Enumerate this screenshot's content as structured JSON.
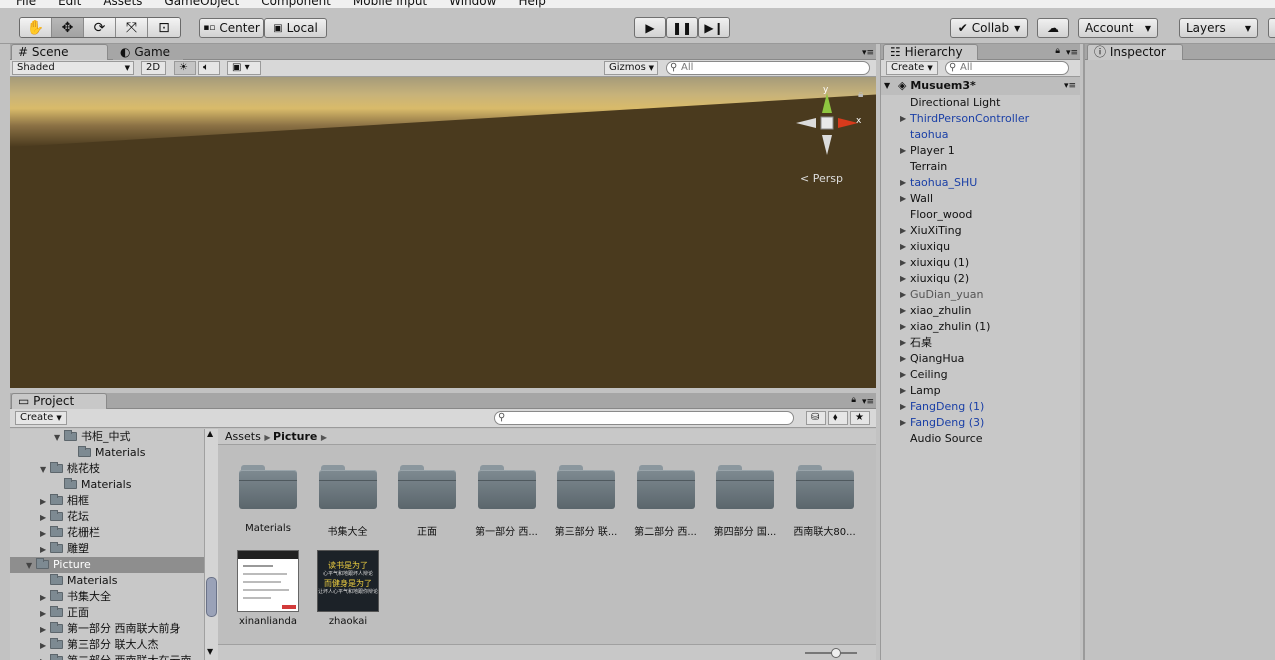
{
  "menu": [
    "File",
    "Edit",
    "Assets",
    "GameObject",
    "Component",
    "Mobile Input",
    "Window",
    "Help"
  ],
  "toolbar": {
    "center_label": "Center",
    "local_label": "Local",
    "collab_label": "Collab",
    "account_label": "Account",
    "layers_label": "Layers"
  },
  "scene": {
    "tab_scene": "Scene",
    "tab_game": "Game",
    "shading": "Shaded",
    "mode_2d": "2D",
    "gizmos": "Gizmos",
    "search_placeholder": "All",
    "persp": "Persp",
    "axis_x": "x",
    "axis_y": "y"
  },
  "hierarchy": {
    "tab": "Hierarchy",
    "create": "Create",
    "search_placeholder": "All",
    "scene_name": "Musuem3*",
    "items": [
      {
        "label": "Directional Light",
        "arrow": false,
        "style": "normal"
      },
      {
        "label": "ThirdPersonController",
        "arrow": true,
        "style": "blue"
      },
      {
        "label": "taohua",
        "arrow": false,
        "style": "blue"
      },
      {
        "label": "Player 1",
        "arrow": true,
        "style": "normal"
      },
      {
        "label": "Terrain",
        "arrow": false,
        "style": "normal"
      },
      {
        "label": "taohua_SHU",
        "arrow": true,
        "style": "blue"
      },
      {
        "label": "Wall",
        "arrow": true,
        "style": "normal"
      },
      {
        "label": "Floor_wood",
        "arrow": false,
        "style": "normal"
      },
      {
        "label": "XiuXiTing",
        "arrow": true,
        "style": "normal"
      },
      {
        "label": "xiuxiqu",
        "arrow": true,
        "style": "normal"
      },
      {
        "label": "xiuxiqu (1)",
        "arrow": true,
        "style": "normal"
      },
      {
        "label": "xiuxiqu (2)",
        "arrow": true,
        "style": "normal"
      },
      {
        "label": "GuDian_yuan",
        "arrow": true,
        "style": "gray"
      },
      {
        "label": "xiao_zhulin",
        "arrow": true,
        "style": "normal"
      },
      {
        "label": "xiao_zhulin (1)",
        "arrow": true,
        "style": "normal"
      },
      {
        "label": "石桌",
        "arrow": true,
        "style": "normal"
      },
      {
        "label": "QiangHua",
        "arrow": true,
        "style": "normal"
      },
      {
        "label": "Ceiling",
        "arrow": true,
        "style": "normal"
      },
      {
        "label": "Lamp",
        "arrow": true,
        "style": "normal"
      },
      {
        "label": "FangDeng (1)",
        "arrow": true,
        "style": "blue"
      },
      {
        "label": "FangDeng (3)",
        "arrow": true,
        "style": "blue"
      },
      {
        "label": "Audio Source",
        "arrow": false,
        "style": "normal"
      }
    ]
  },
  "inspector": {
    "tab": "Inspector"
  },
  "project": {
    "tab": "Project",
    "create": "Create",
    "breadcrumb": [
      "Assets",
      "Picture"
    ],
    "tree": [
      {
        "label": "书柜_中式",
        "indent": 4,
        "arrow": "down",
        "sel": false
      },
      {
        "label": "Materials",
        "indent": 5,
        "arrow": "",
        "sel": false
      },
      {
        "label": "桃花枝",
        "indent": 3,
        "arrow": "down",
        "sel": false
      },
      {
        "label": "Materials",
        "indent": 4,
        "arrow": "",
        "sel": false
      },
      {
        "label": "相框",
        "indent": 3,
        "arrow": "right",
        "sel": false
      },
      {
        "label": "花坛",
        "indent": 3,
        "arrow": "right",
        "sel": false
      },
      {
        "label": "花栅栏",
        "indent": 3,
        "arrow": "right",
        "sel": false
      },
      {
        "label": "雕塑",
        "indent": 3,
        "arrow": "right",
        "sel": false
      },
      {
        "label": "Picture",
        "indent": 2,
        "arrow": "down",
        "sel": true
      },
      {
        "label": "Materials",
        "indent": 3,
        "arrow": "",
        "sel": false
      },
      {
        "label": "书集大全",
        "indent": 3,
        "arrow": "right",
        "sel": false
      },
      {
        "label": "正面",
        "indent": 3,
        "arrow": "right",
        "sel": false
      },
      {
        "label": "第一部分  西南联大前身",
        "indent": 3,
        "arrow": "right",
        "sel": false
      },
      {
        "label": "第三部分  联大人杰",
        "indent": 3,
        "arrow": "right",
        "sel": false
      },
      {
        "label": "第二部分  西南联大在云南",
        "indent": 3,
        "arrow": "right",
        "sel": false
      }
    ],
    "folders": [
      "Materials",
      "书集大全",
      "正面",
      "第一部分  西...",
      "第三部分  联...",
      "第二部分  西...",
      "第四部分  国...",
      "西南联大80..."
    ],
    "images": [
      {
        "label": "xinanlianda"
      },
      {
        "label": "zhaokai",
        "line1": "读书是为了",
        "line2": "心平气和地跟坏人辩论",
        "line3": "而健身是为了",
        "line4": "让坏人心平气和地跟你辩论"
      }
    ]
  }
}
